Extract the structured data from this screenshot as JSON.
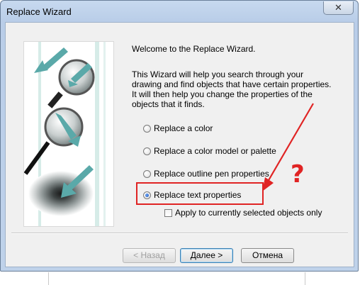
{
  "window": {
    "title": "Replace Wizard",
    "close_label": "✕"
  },
  "content": {
    "welcome": "Welcome to the Replace Wizard.",
    "intro": "This Wizard will help you search through your drawing and find objects that have certain properties. It will then help you change the properties of the objects that it finds."
  },
  "options": [
    {
      "label": "Replace a color",
      "checked": false
    },
    {
      "label": "Replace a color model or palette",
      "checked": false
    },
    {
      "label": "Replace outline pen properties",
      "checked": false
    },
    {
      "label": "Replace text properties",
      "checked": true
    }
  ],
  "apply_checkbox": {
    "label": "Apply to currently selected objects only",
    "checked": false
  },
  "annotation": {
    "question_mark": "?",
    "color": "#e02424"
  },
  "buttons": {
    "back": "< Назад",
    "next": "Далее >",
    "cancel": "Отмена"
  },
  "colors": {
    "title_bar": "#bfd2ea",
    "dialog_bg": "#f0f0f0",
    "highlight": "#e02424"
  }
}
